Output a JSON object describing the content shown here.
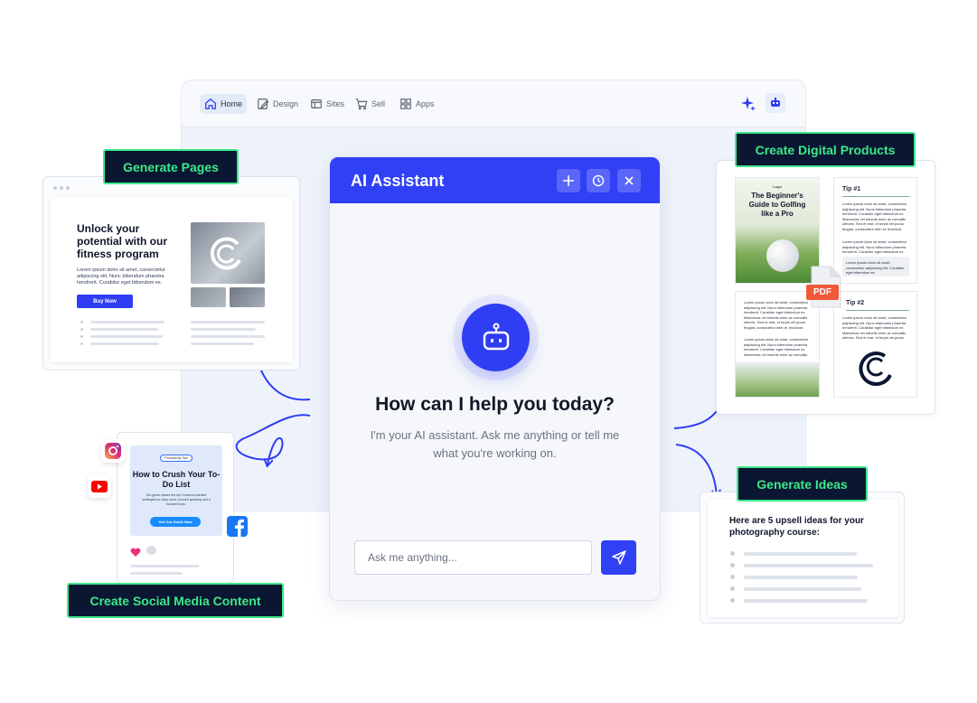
{
  "app_nav": {
    "items": [
      {
        "label": "Home",
        "icon": "home-icon"
      },
      {
        "label": "Design",
        "icon": "pencil-icon"
      },
      {
        "label": "Sites",
        "icon": "browser-icon"
      },
      {
        "label": "Sell",
        "icon": "cart-icon"
      },
      {
        "label": "Apps",
        "icon": "grid-icon"
      }
    ],
    "active": "Home"
  },
  "assistant": {
    "title": "AI Assistant",
    "heading": "How can I help you today?",
    "subtitle": "I'm your AI assistant. Ask me anything or tell me what you're working on.",
    "input_placeholder": "Ask me anything...",
    "accent": "#3040f5"
  },
  "tags": {
    "pages": "Generate Pages",
    "social": "Create Social Media Content",
    "products": "Create Digital Products",
    "ideas": "Generate Ideas"
  },
  "pages_preview": {
    "headline": "Unlock your potential with our fitness program",
    "body": "Lorem ipsum dolor sit amet, consectetur adipiscing elit. Nunc bibendum pharetra hendrerit. Curabitur eget bibendum ex.",
    "button": "Buy Now"
  },
  "social_preview": {
    "pill": "Productivity Tips",
    "title": "How to Crush Your To-Do List",
    "body": "Our guide shares the top 5 science-backed strategies for deep work, focused sprinting and a focused tools.",
    "cta": "Get Our Guide Now"
  },
  "products_preview": {
    "logo": "Logo",
    "cover_title": "The Beginner's Guide to Golfing like a Pro",
    "tip1": "Tip #1",
    "tip2": "Tip #2",
    "body": "Lorem ipsum dolor sit amet, consectetur adipiscing elit. Nunc bibendum pharetra hendrerit. Curabitur eget bibendum ex. Maecenas vel lobortis enim ac convallis ultrices. Sed et erat, id turpis vel purus feugiat, consectetur nibh et, tincidunt.",
    "callout": "Lorem ipsum dolor sit amet, consectetur adipiscing elit. Curabitur eget bibendum ex.",
    "pdf_label": "PDF"
  },
  "ideas_preview": {
    "heading": "Here are 5 upsell ideas for your photography course:"
  }
}
